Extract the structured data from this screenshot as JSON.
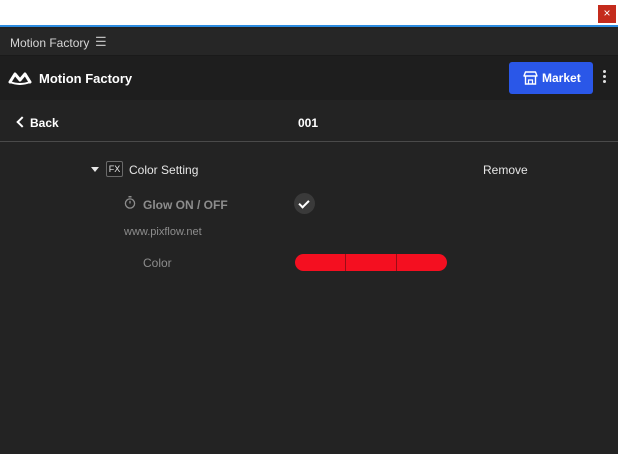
{
  "window": {
    "close_glyph": "×"
  },
  "panel": {
    "title": "Motion Factory",
    "menu_glyph": "☰"
  },
  "header": {
    "app_name": "Motion Factory",
    "market_label": "Market",
    "icons": {
      "logo": "motion-factory-logo-icon",
      "market": "store-icon",
      "more": "kebab-menu-icon"
    },
    "accent_color": "#2a57e8"
  },
  "subnav": {
    "back_label": "Back",
    "page_id": "001"
  },
  "effect": {
    "name": "Color Setting",
    "fx_badge": "FX",
    "remove_label": "Remove",
    "glow_label": "Glow ON / OFF",
    "glow_enabled": true,
    "watermark": "www.pixflow.net",
    "color_label": "Color",
    "color_value": "#f40f20"
  }
}
